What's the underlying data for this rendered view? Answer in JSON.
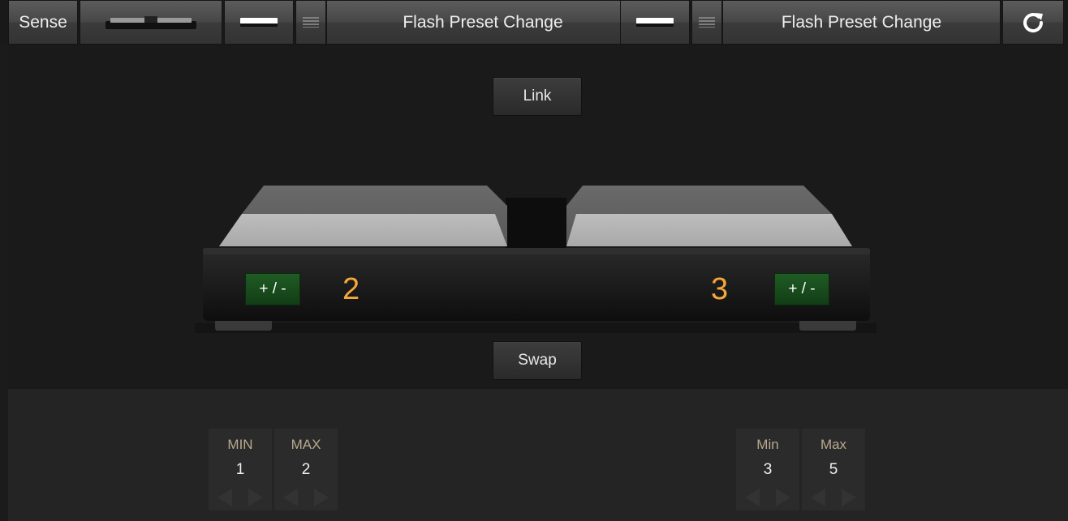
{
  "toolbar": {
    "sense_label": "Sense",
    "left_slot": {
      "title": "Flash Preset Change"
    },
    "right_slot": {
      "title": "Flash Preset Change"
    }
  },
  "main": {
    "link_label": "Link",
    "swap_label": "Swap",
    "left_pedal": {
      "plusminus_label": "+ / -",
      "value": "2"
    },
    "right_pedal": {
      "plusminus_label": "+ / -",
      "value": "3"
    }
  },
  "ranges": {
    "left": {
      "min_label": "MIN",
      "min_value": "1",
      "max_label": "MAX",
      "max_value": "2"
    },
    "right": {
      "min_label": "Min",
      "min_value": "3",
      "max_label": "Max",
      "max_value": "5"
    }
  },
  "colors": {
    "accent_number": "#f5a83a",
    "plusminus_green": "#1f5c24"
  },
  "icons": [
    "pedal-device-icon",
    "mode-bar-icon",
    "menu-lines-icon",
    "refresh-icon",
    "arrow-left-icon",
    "arrow-right-icon"
  ]
}
